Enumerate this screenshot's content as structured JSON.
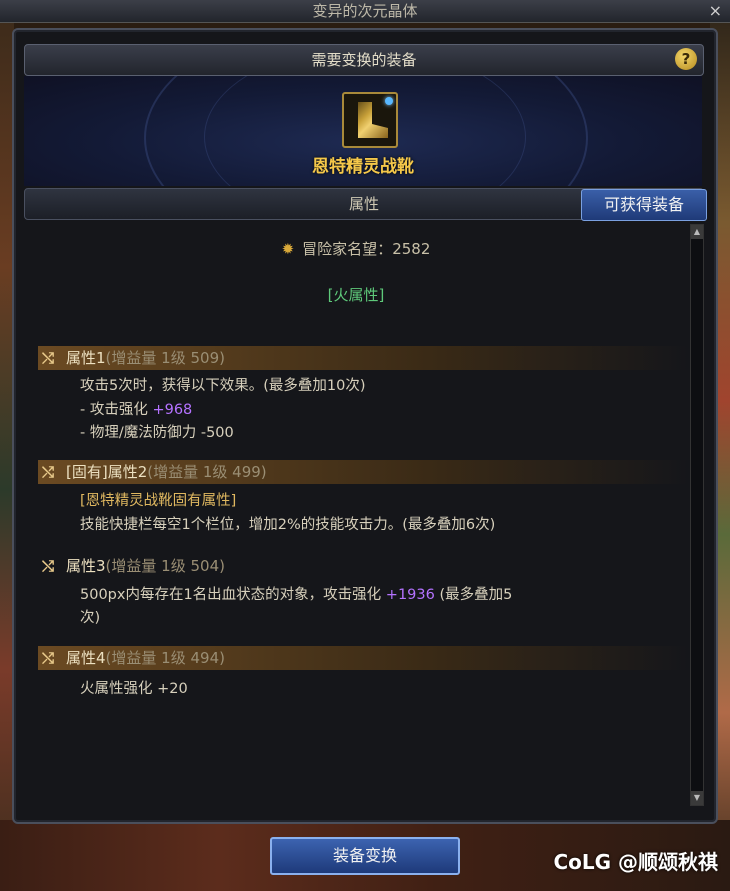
{
  "window": {
    "title": "变异的次元晶体",
    "close": "×"
  },
  "header": {
    "title": "需要变换的装备",
    "help": "?"
  },
  "item": {
    "name": "恩特精灵战靴"
  },
  "attributes_bar": {
    "title": "属性",
    "obtain_button": "可获得装备"
  },
  "reputation": {
    "label": "冒险家名望",
    "separator": "：",
    "value": "2582"
  },
  "element": "[火属性]",
  "attrs": [
    {
      "title": "属性1",
      "sub": "(增益量 1级 509)",
      "lines": [
        "攻击5次时，获得以下效果。(最多叠加10次)",
        "- 攻击强化 ",
        "+968",
        "- 物理/魔法防御力 -500"
      ]
    },
    {
      "title": "[固有]属性2",
      "sub": "(增益量 1级 499)",
      "lines": [
        "[恩特精灵战靴固有属性]",
        "技能快捷栏每空1个栏位，增加2%的技能攻击力。(最多叠加6次)"
      ]
    },
    {
      "title": "属性3",
      "sub": "(增益量 1级 504)",
      "lines": [
        "500px内每存在1名出血状态的对象，攻击强化 ",
        "+1936",
        " (最多叠加5",
        "次)"
      ]
    },
    {
      "title": "属性4",
      "sub": "(增益量 1级 494)",
      "lines": [
        "火属性强化 +20"
      ]
    }
  ],
  "footer": {
    "convert_button": "装备变换",
    "watermark": "CoLG @顺颂秋祺"
  },
  "icons": [
    "close-icon",
    "help-icon",
    "boot-icon",
    "reputation-icon",
    "shuffle-icon"
  ],
  "colors": {
    "gold": "#f5c84a",
    "green": "#5ec97a",
    "purple": "#b472ff",
    "button_blue": "#1f3a78"
  }
}
